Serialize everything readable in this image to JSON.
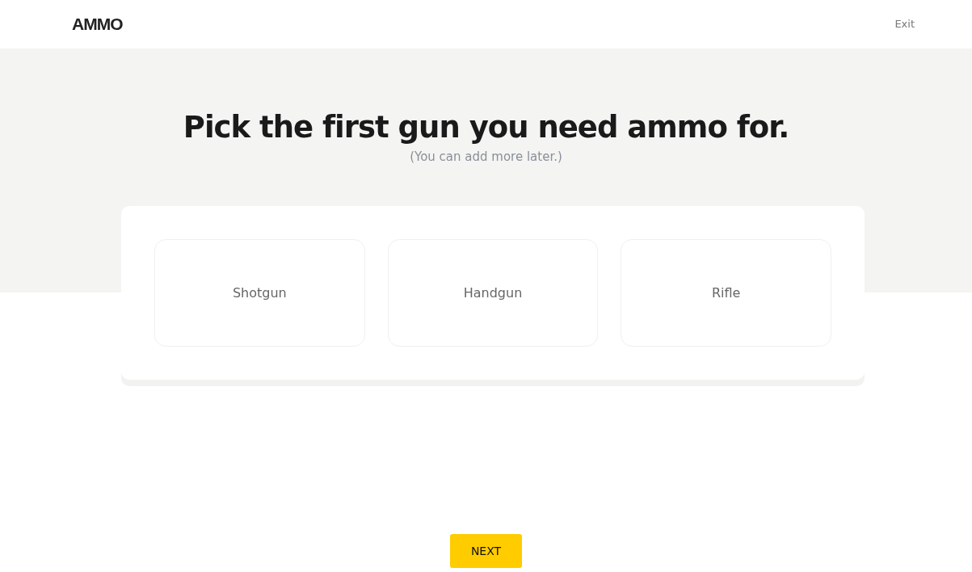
{
  "header": {
    "logo": "AMMO",
    "exit": "Exit"
  },
  "title": "Pick the first gun you need ammo for.",
  "subtitle": "(You can add more later.)",
  "options": [
    {
      "label": "Shotgun"
    },
    {
      "label": "Handgun"
    },
    {
      "label": "Rifle"
    }
  ],
  "next_button": "NEXT"
}
